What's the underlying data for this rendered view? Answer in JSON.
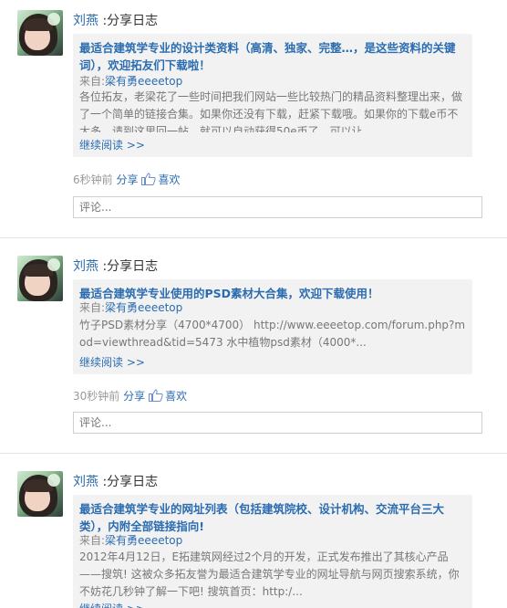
{
  "posts": [
    {
      "name": "刘燕",
      "action": " :分享日志",
      "title": "最适合建筑学专业的设计类资料（高清、独家、完整…，是这些资料的关键词），欢迎拓友们下载啦！",
      "from_prefix": "来自:",
      "source": "梁有勇eeeetop",
      "excerpt": "各位拓友，老梁花了一些时间把我们网站一些比较热门的精品资料整理出来，做了一个简单的链接合集。如果你还没有下载，赶紧下载哦。如果你的下载e币不太多，请到这里回一帖，就可以自动获得50e币了，可以让...",
      "more": "继续阅读 >>",
      "time": "6秒钟前",
      "share": "分享",
      "like": "喜欢",
      "comment_placeholder": "评论..."
    },
    {
      "name": "刘燕",
      "action": " :分享日志",
      "title": "最适合建筑学专业使用的PSD素材大合集，欢迎下载使用！",
      "from_prefix": "来自:",
      "source": "梁有勇eeeetop",
      "excerpt": "竹子PSD素材分享（4700*4700） http://www.eeeetop.com/forum.php?mod=viewthread&tid=5473 水中植物psd素材（4000*...",
      "more": "继续阅读 >>",
      "time": "30秒钟前",
      "share": "分享",
      "like": "喜欢",
      "comment_placeholder": "评论..."
    },
    {
      "name": "刘燕",
      "action": " :分享日志",
      "title": "最适合建筑学专业的网址列表（包括建筑院校、设计机构、交流平台三大类），内附全部链接指向!",
      "from_prefix": "来自:",
      "source": "梁有勇eeeetop",
      "excerpt": "2012年4月12日，E拓建筑网经过2个月的开发，正式发布推出了其核心产品——搜筑! 这被众多拓友誉为最适合建筑学专业的网址导航与网页搜索系统，你不妨花几秒钟了解一下吧! 搜筑首页：http:/...",
      "more": "继续阅读 >>"
    }
  ]
}
